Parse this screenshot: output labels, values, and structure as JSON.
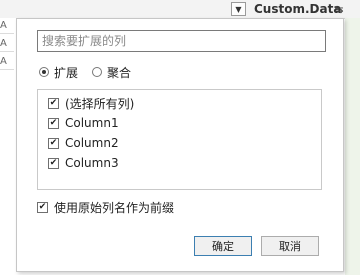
{
  "column_header": {
    "title": "Custom.Data",
    "dropdown_icon": "chevron-down-icon",
    "expand_icon": "expand-columns-icon"
  },
  "background_rows": [
    "A",
    "A",
    "A"
  ],
  "popup": {
    "search": {
      "placeholder": "搜索要扩展的列",
      "value": ""
    },
    "mode_options": [
      {
        "label": "扩展",
        "selected": true
      },
      {
        "label": "聚合",
        "selected": false
      }
    ],
    "columns": [
      {
        "label": "(选择所有列)",
        "checked": true
      },
      {
        "label": "Column1",
        "checked": true
      },
      {
        "label": "Column2",
        "checked": true
      },
      {
        "label": "Column3",
        "checked": true
      }
    ],
    "use_prefix": {
      "label": "使用原始列名作为前缀",
      "checked": true
    },
    "buttons": {
      "ok": "确定",
      "cancel": "取消"
    }
  },
  "colors": {
    "ok_border": "#3c7fb1",
    "right_strip": "#eef4ea"
  }
}
